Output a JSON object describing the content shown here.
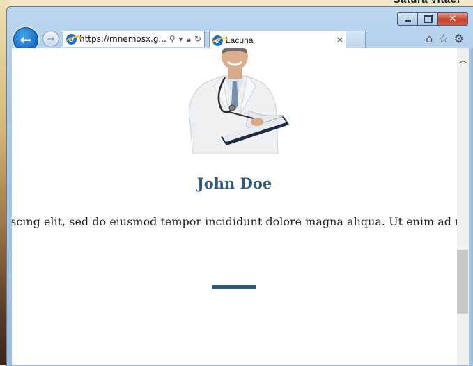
{
  "desktop": {
    "corner_text": "Satura vitae!"
  },
  "browser": {
    "address_text": "https://mnemosx.g...",
    "tab_title": "Lacuna",
    "colors": {
      "accent": "#2f5a7e",
      "back_button": "#1a73c9"
    }
  },
  "page": {
    "person_name": "John Doe",
    "bio_text": "scing elit, sed do eiusmod tempor incididunt dolore magna aliqua. Ut enim ad minim"
  }
}
